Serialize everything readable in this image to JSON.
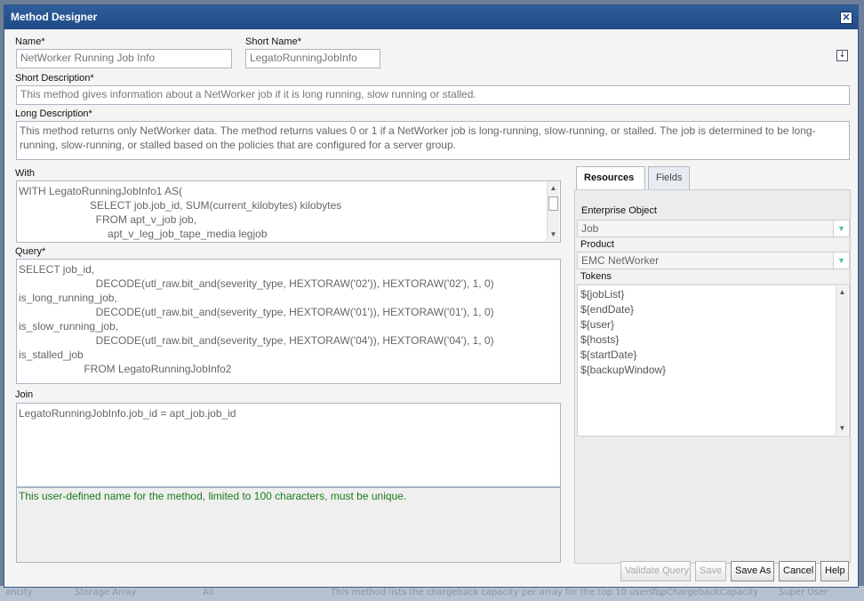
{
  "background": {
    "strip": [
      "ancity",
      "Storage Array",
      "All",
      "This method lists the chargeback capacity per array for the top 10 users ...",
      "TopChargebackCapacity",
      "Super User"
    ]
  },
  "dialog": {
    "title": "Method Designer",
    "close_glyph": "✕"
  },
  "form": {
    "name_label": "Name*",
    "name_value": "NetWorker Running Job Info",
    "short_name_label": "Short Name*",
    "short_name_value": "LegatoRunningJobInfo",
    "short_desc_label": "Short Description*",
    "short_desc_value": "This method gives information about a NetWorker job if it is long running, slow running or stalled.",
    "long_desc_label": "Long Description*",
    "long_desc_value": "This method returns only NetWorker data. The method returns values 0 or 1 if a NetWorker job is long-running, slow-running, or stalled. The job is determined to be long-running, slow-running, or stalled based on the policies that are configured for a server group.",
    "with_label": "With",
    "with_lines": [
      "WITH LegatoRunningJobInfo1 AS(",
      "                        SELECT job.job_id, SUM(current_kilobytes) kilobytes",
      "                          FROM apt_v_job job,",
      "                              apt_v_leg_job_tape_media legjob"
    ],
    "query_label": "Query*",
    "query_lines": [
      "SELECT job_id,",
      "                          DECODE(utl_raw.bit_and(severity_type, HEXTORAW('02')), HEXTORAW('02'), 1, 0)",
      "is_long_running_job,",
      "                          DECODE(utl_raw.bit_and(severity_type, HEXTORAW('01')), HEXTORAW('01'), 1, 0)",
      "is_slow_running_job,",
      "                          DECODE(utl_raw.bit_and(severity_type, HEXTORAW('04')), HEXTORAW('04'), 1, 0)",
      "is_stalled_job",
      "                      FROM LegatoRunningJobInfo2"
    ],
    "join_label": "Join",
    "join_value": "LegatoRunningJobInfo.job_id = apt_job.job_id",
    "hint": "This user-defined name for the method, limited to 100 characters, must be unique."
  },
  "right_panel": {
    "tabs": [
      "Resources",
      "Fields"
    ],
    "enterprise_object_label": "Enterprise Object",
    "enterprise_object_value": "Job",
    "product_label": "Product",
    "product_value": "EMC NetWorker",
    "tokens_label": "Tokens",
    "tokens": [
      "${jobList}",
      "${endDate}",
      "${user}",
      "${hosts}",
      "${startDate}",
      "${backupWindow}"
    ]
  },
  "buttons": {
    "validate": "Validate Query",
    "save": "Save",
    "save_as": "Save As",
    "cancel": "Cancel",
    "help": "Help"
  }
}
